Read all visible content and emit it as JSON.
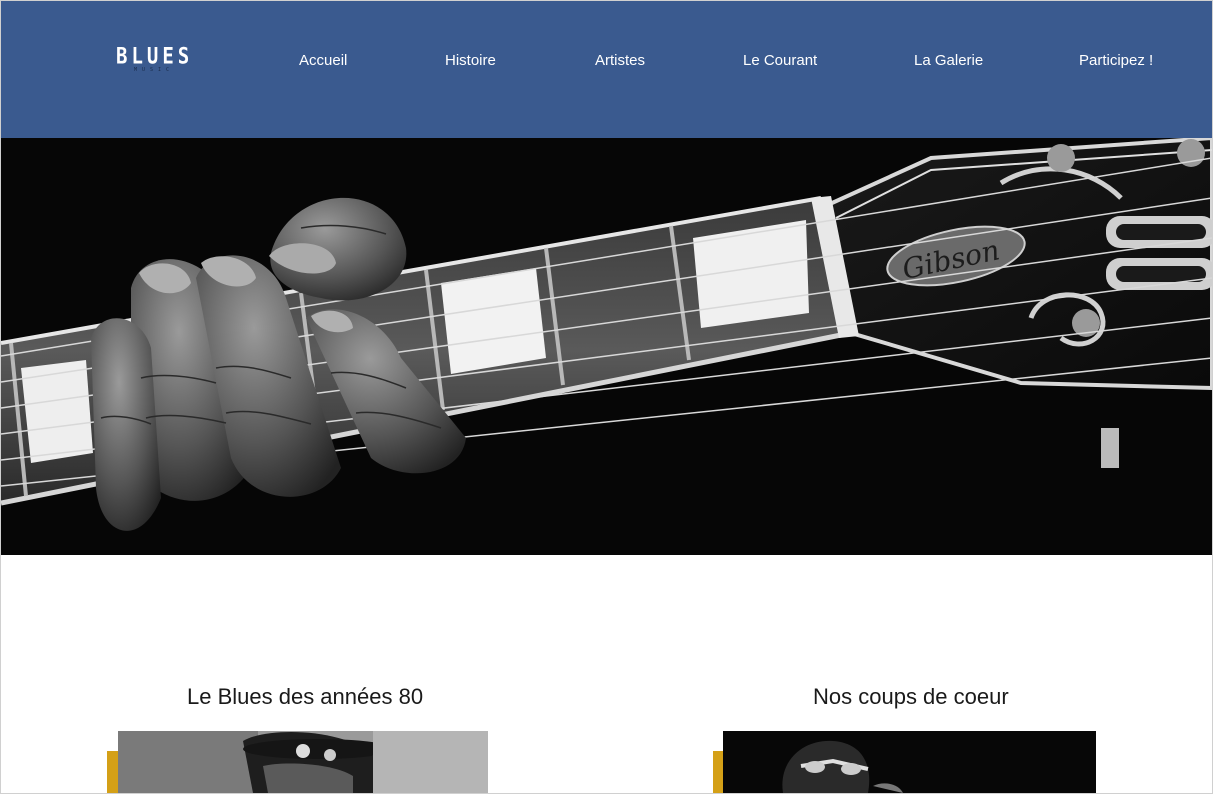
{
  "header": {
    "logo": {
      "main": "BLUES",
      "sub": "MUSIC"
    },
    "nav": [
      {
        "label": "Accueil"
      },
      {
        "label": "Histoire"
      },
      {
        "label": "Artistes"
      },
      {
        "label": "Le Courant"
      },
      {
        "label": "La Galerie"
      },
      {
        "label": "Participez !"
      }
    ],
    "background_color": "#3a5a8f"
  },
  "hero": {
    "image_alt": "guitar-neck-hand-photo",
    "brand_on_headstock": "Gibson"
  },
  "sections": [
    {
      "title": "Le Blues des années 80",
      "image": "musician-with-hat-photo"
    },
    {
      "title": "Nos coups de coeur",
      "image": "singer-with-sunglasses-photo"
    }
  ],
  "colors": {
    "accent": "#d4a017",
    "header": "#3a5a8f",
    "text": "#1a1a1a"
  }
}
